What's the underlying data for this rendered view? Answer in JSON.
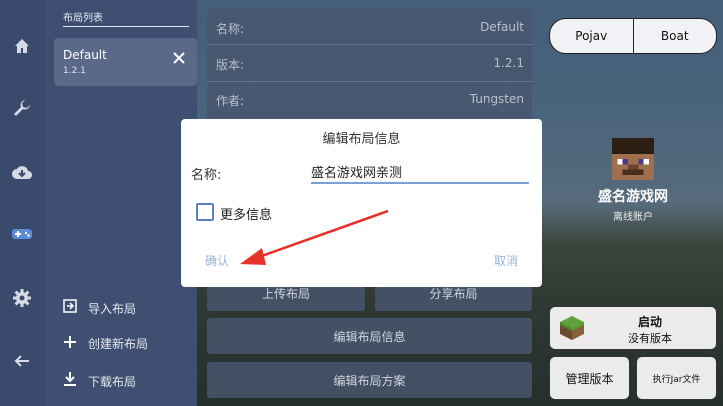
{
  "rail": {
    "items": [
      {
        "icon": "home-icon",
        "glyph": "⌂"
      },
      {
        "icon": "wrench-icon",
        "glyph": "🔧"
      },
      {
        "icon": "cloud-download-icon",
        "glyph": "☁"
      },
      {
        "icon": "gamepad-icon",
        "glyph": "🎮"
      },
      {
        "icon": "gear-icon",
        "glyph": "⚙"
      },
      {
        "icon": "back-arrow-icon",
        "glyph": "←"
      }
    ]
  },
  "layout_list": {
    "title": "布局列表",
    "item": {
      "name": "Default",
      "version": "1.2.1"
    },
    "actions": {
      "import": "导入布局",
      "create": "创建新布局",
      "download": "下载布局"
    }
  },
  "info": {
    "name_label": "名称:",
    "name_value": "Default",
    "version_label": "版本:",
    "version_value": "1.2.1",
    "author_label": "作者:",
    "author_value": "Tungsten"
  },
  "buttons": {
    "upload": "上传布局",
    "share": "分享布局",
    "edit_info": "编辑布局信息",
    "edit_scheme": "编辑布局方案"
  },
  "right": {
    "seg_left": "Pojav",
    "seg_right": "Boat",
    "username": "盛名游戏网",
    "account_type": "离线账户",
    "launch_title": "启动",
    "launch_sub": "没有版本",
    "manage_versions": "管理版本",
    "run_jar": "执行Jar文件"
  },
  "dialog": {
    "title": "编辑布局信息",
    "name_label": "名称:",
    "name_value": "盛名游戏网亲测",
    "more_info": "更多信息",
    "confirm": "确认",
    "cancel": "取消"
  },
  "colors": {
    "rail": "#394a6c",
    "panel": "#3e4f71",
    "accent": "#e8302a",
    "input_underline": "#7aa2d8"
  }
}
